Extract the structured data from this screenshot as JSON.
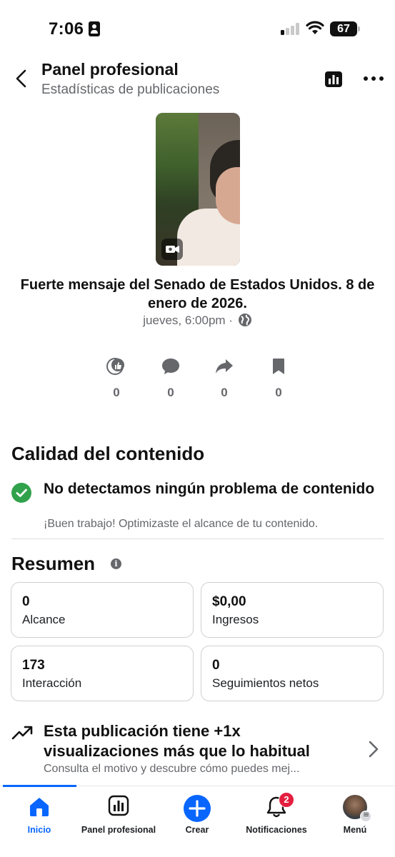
{
  "status_bar": {
    "time": "7:06",
    "battery": "67"
  },
  "header": {
    "title": "Panel profesional",
    "subtitle": "Estadísticas de publicaciones"
  },
  "post": {
    "title": "Fuerte mensaje del Senado de Estados Unidos.  8 de enero de 2026.",
    "meta": "jueves, 6:00pm ·",
    "engagement": {
      "reactions": "0",
      "comments": "0",
      "shares": "0",
      "saves": "0"
    }
  },
  "content_quality": {
    "heading": "Calidad del contenido",
    "status_title": "No detectamos ningún problema de contenido",
    "status_sub": "¡Buen trabajo! Optimizaste el alcance de tu contenido."
  },
  "summary": {
    "heading": "Resumen",
    "cards": [
      {
        "value": "0",
        "label": "Alcance"
      },
      {
        "value": "$0,00",
        "label": "Ingresos"
      },
      {
        "value": "173",
        "label": "Interacción"
      },
      {
        "value": "0",
        "label": "Seguimientos netos"
      }
    ]
  },
  "insight": {
    "title": "Esta publicación tiene +1x visualizaciones más que lo habitual",
    "subtitle": "Consulta el motivo y descubre cómo puedes mej..."
  },
  "bottom_nav": {
    "items": [
      {
        "label": "Inicio",
        "icon": "home-icon"
      },
      {
        "label": "Panel profesional",
        "icon": "dashboard-icon"
      },
      {
        "label": "Crear",
        "icon": "plus-icon"
      },
      {
        "label": "Notificaciones",
        "icon": "bell-icon",
        "badge": "2"
      },
      {
        "label": "Menú",
        "icon": "avatar"
      }
    ]
  },
  "colors": {
    "accent": "#0866ff",
    "success": "#31a24c",
    "badge": "#e41e3f",
    "secondary_text": "#65676b"
  }
}
